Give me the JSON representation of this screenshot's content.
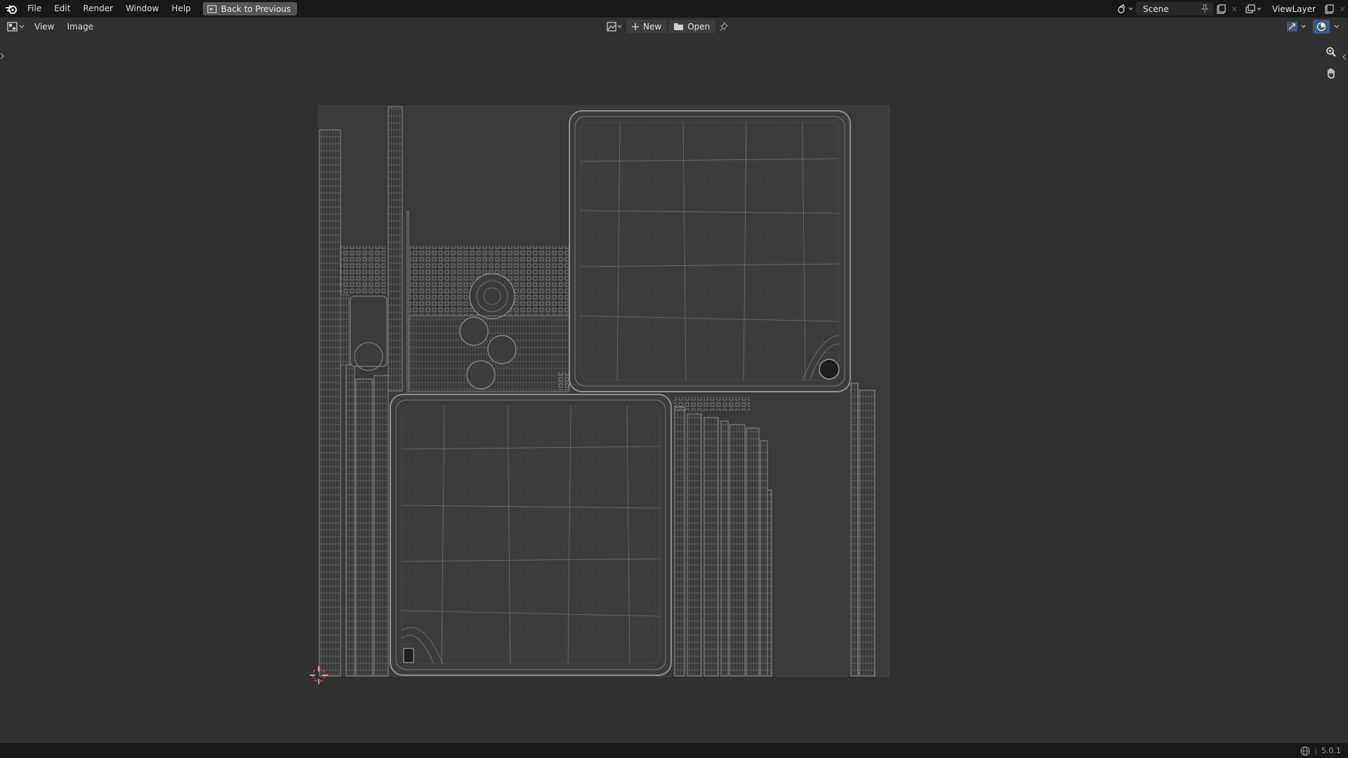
{
  "topbar": {
    "menus": [
      "File",
      "Edit",
      "Render",
      "Window",
      "Help"
    ],
    "back_button": "Back to Previous",
    "scene": "Scene",
    "view_layer": "ViewLayer"
  },
  "image_header": {
    "menus": [
      "View",
      "Image"
    ],
    "new_label": "New",
    "open_label": "Open"
  },
  "status": {
    "version": "5.0.1"
  },
  "colors": {
    "topbar_bg": "#181818",
    "area_bg": "#303030",
    "wire": "#8c8c8c",
    "accent_blue": "#3d5a80"
  }
}
